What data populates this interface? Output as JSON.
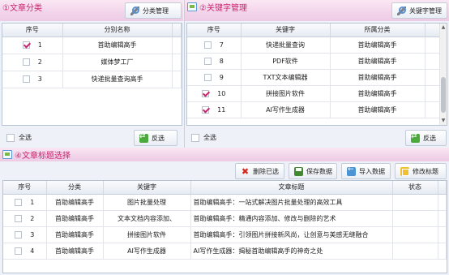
{
  "category_panel": {
    "title": "①文章分类",
    "manage_button": "分类管理",
    "columns": [
      "序号",
      "分别名称"
    ],
    "rows": [
      {
        "index": "1",
        "name": "首助编辑高手",
        "checked": true
      },
      {
        "index": "2",
        "name": "媒体梦工厂",
        "checked": false
      },
      {
        "index": "3",
        "name": "快递批量查询高手",
        "checked": false
      }
    ],
    "select_all_label": "全选",
    "invert_button": "反选"
  },
  "keyword_panel": {
    "title": "②关键字管理",
    "manage_button": "关键字管理",
    "columns": [
      "序号",
      "关键字",
      "所属分类"
    ],
    "rows": [
      {
        "index": "7",
        "keyword": "快递批量查询",
        "category": "首助编辑高手",
        "checked": false
      },
      {
        "index": "8",
        "keyword": "PDF软件",
        "category": "首助编辑高手",
        "checked": false
      },
      {
        "index": "9",
        "keyword": "TXT文本编辑器",
        "category": "首助编辑高手",
        "checked": false
      },
      {
        "index": "10",
        "keyword": "拼接图片软件",
        "category": "首助编辑高手",
        "checked": true
      },
      {
        "index": "11",
        "keyword": "AI写作生成器",
        "category": "首助编辑高手",
        "checked": true
      }
    ],
    "select_all_label": "全选",
    "invert_button": "反选"
  },
  "title_panel": {
    "title": "④文章标题选择",
    "buttons": {
      "delete": "删除已选",
      "save": "保存数据",
      "import": "导入数据",
      "edit": "修改标题"
    },
    "columns": [
      "序号",
      "分类",
      "关键字",
      "文章标题",
      "状态"
    ],
    "rows": [
      {
        "index": "1",
        "category": "首助编辑高手",
        "keyword": "图片批量处理",
        "title": "首助编辑高手：一站式解决图片批量处理的高效工具",
        "status": ""
      },
      {
        "index": "2",
        "category": "首助编辑高手",
        "keyword": "文本文档内容添加、",
        "title": "首助编辑高手：精通内容添加、修改与删除的艺术",
        "status": ""
      },
      {
        "index": "3",
        "category": "首助编辑高手",
        "keyword": "拼接图片软件",
        "title": "首助编辑高手：引领图片拼接新风尚，让创意与美感无缝融合",
        "status": ""
      },
      {
        "index": "4",
        "category": "首助编辑高手",
        "keyword": "AI写作生成器",
        "title": "AI写作生成器：揭秘首助编辑高手的神奇之处",
        "status": ""
      }
    ]
  }
}
